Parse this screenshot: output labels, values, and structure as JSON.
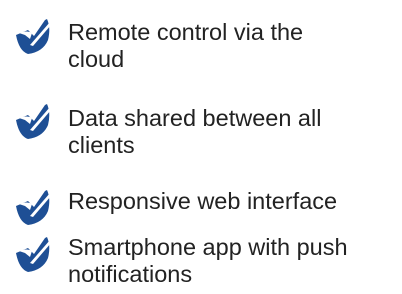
{
  "icon": "checkmark-circle-icon",
  "accent_color": "#1e4f95",
  "features": [
    {
      "label_line1": "Remote control via the",
      "label_line2": "cloud"
    },
    {
      "label_line1": "Data shared between all",
      "label_line2": "clients"
    },
    {
      "label_line1": "Responsive web interface",
      "label_line2": ""
    },
    {
      "label_line1": "Smartphone app with push",
      "label_line2": "notifications"
    }
  ]
}
